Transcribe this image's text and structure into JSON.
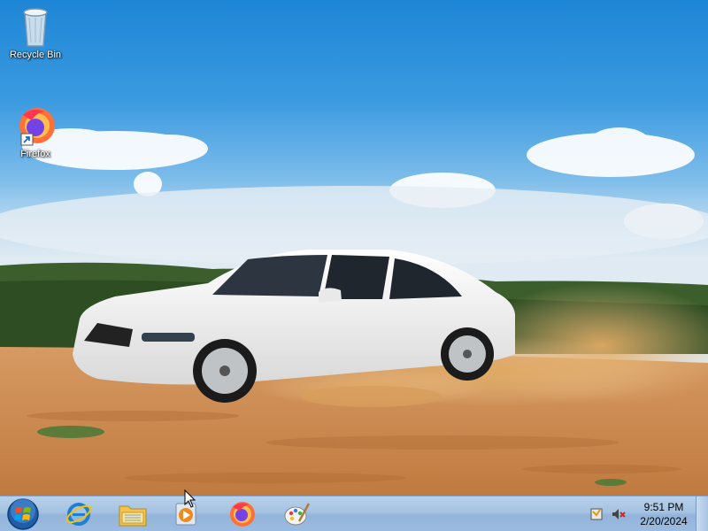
{
  "desktop": {
    "icons": [
      {
        "label": "Recycle Bin",
        "icon": "recycle-bin-icon"
      },
      {
        "label": "Firefox",
        "icon": "firefox-icon"
      }
    ]
  },
  "taskbar": {
    "pinned": [
      {
        "name": "internet-explorer",
        "icon": "internet-explorer-icon"
      },
      {
        "name": "windows-explorer",
        "icon": "folder-icon"
      },
      {
        "name": "media-player",
        "icon": "media-player-icon"
      },
      {
        "name": "firefox",
        "icon": "firefox-icon"
      },
      {
        "name": "paint",
        "icon": "paint-icon"
      }
    ],
    "tray": {
      "time": "9:51 PM",
      "date": "2/20/2024"
    }
  },
  "colors": {
    "sky": "#1e86d6",
    "taskbar": "#a5c2e2",
    "sand": "#c98a4f",
    "car": "#eeeeee"
  }
}
